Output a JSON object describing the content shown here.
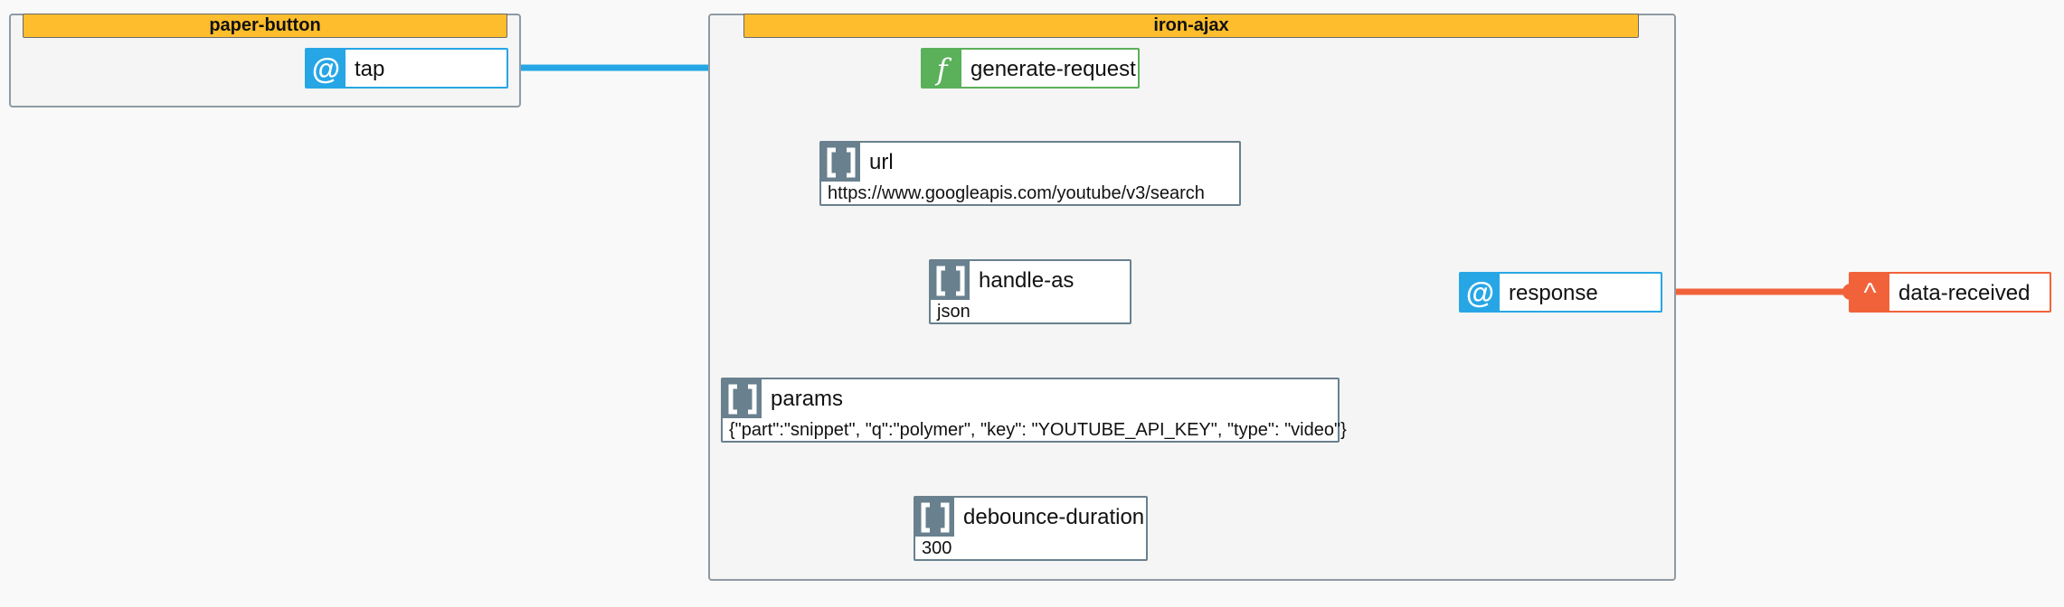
{
  "components": [
    {
      "id": "paper-button",
      "title": "paper-button"
    },
    {
      "id": "iron-ajax",
      "title": "iron-ajax"
    }
  ],
  "nodes": {
    "tap": {
      "kind": "event",
      "label": "tap",
      "icon": "at-icon",
      "glyph": "@"
    },
    "generate_request": {
      "kind": "method",
      "label": "generate-request",
      "icon": "function-icon",
      "glyph": "f"
    },
    "url": {
      "kind": "property",
      "label": "url",
      "value": "https://www.googleapis.com/youtube/v3/search",
      "icon": "brackets-icon"
    },
    "handle_as": {
      "kind": "property",
      "label": "handle-as",
      "value": "json",
      "icon": "brackets-icon"
    },
    "params": {
      "kind": "property",
      "label": "params",
      "value": "{\"part\":\"snippet\", \"q\":\"polymer\", \"key\": \"YOUTUBE_API_KEY\", \"type\": \"video\"}",
      "icon": "brackets-icon"
    },
    "debounce_duration": {
      "kind": "property",
      "label": "debounce-duration",
      "value": "300",
      "icon": "brackets-icon"
    },
    "response": {
      "kind": "event",
      "label": "response",
      "icon": "at-icon",
      "glyph": "@"
    },
    "data_received": {
      "kind": "fire",
      "label": "data-received",
      "icon": "caret-up-icon",
      "glyph": "^"
    }
  },
  "connections": [
    {
      "from": "tap",
      "to": "generate_request",
      "color": "#27a6e5"
    },
    {
      "from": "response",
      "to": "data_received",
      "color": "#f2623a"
    }
  ],
  "colors": {
    "event": "#27a6e5",
    "method": "#5bb05a",
    "property": "#69808e",
    "fire": "#f2623a",
    "component_header": "#fdbd2c"
  }
}
